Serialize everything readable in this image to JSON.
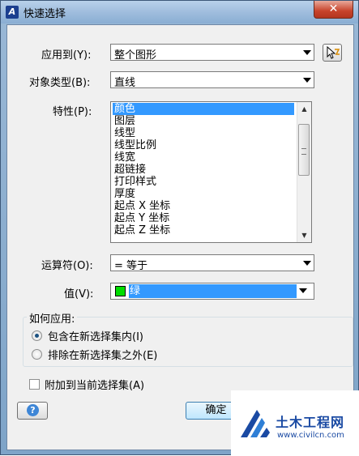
{
  "window": {
    "title": "快速选择",
    "close_glyph": "✕"
  },
  "form": {
    "apply_to_label": "应用到(Y):",
    "apply_to_value": "整个图形",
    "object_type_label": "对象类型(B):",
    "object_type_value": "直线",
    "properties_label": "特性(P):",
    "properties": [
      "颜色",
      "图层",
      "线型",
      "线型比例",
      "线宽",
      "超链接",
      "打印样式",
      "厚度",
      "起点 X 坐标",
      "起点 Y 坐标",
      "起点 Z 坐标"
    ],
    "selected_property": "颜色",
    "operator_label": "运算符(O):",
    "operator_value": "= 等于",
    "value_label": "值(V):",
    "value_value": "绿",
    "value_color": "#00dd00"
  },
  "how_to_apply": {
    "title": "如何应用:",
    "include_label": "包含在新选择集内(I)",
    "exclude_label": "排除在新选择集之外(E)",
    "selected": "include"
  },
  "append_label": "附加到当前选择集(A)",
  "append_checked": false,
  "buttons": {
    "ok_label": "确定",
    "help_glyph": "?"
  },
  "watermark": {
    "name": "土木工程网",
    "url": "www.civilcn.com"
  },
  "icons": [
    "app-icon",
    "close-icon",
    "pick-objects-icon",
    "help-icon",
    "chevron-down-icon"
  ]
}
